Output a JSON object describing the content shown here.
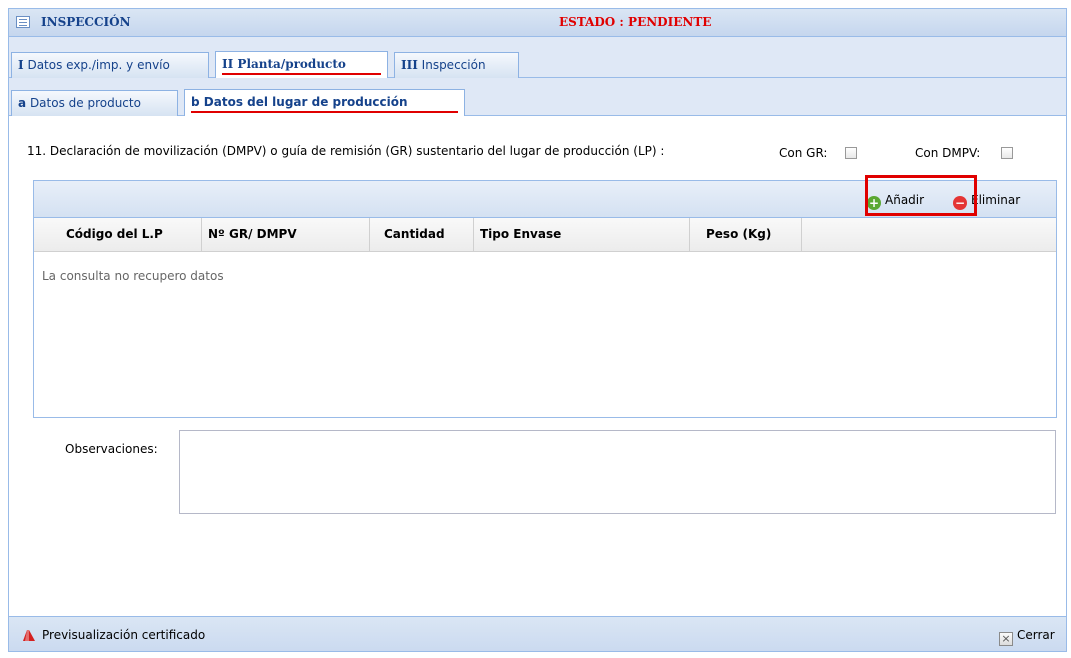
{
  "window": {
    "title": "INSPECCIÓN",
    "status": "ESTADO : PENDIENTE"
  },
  "tabs_level1": [
    {
      "roman": "I",
      "label": "Datos exp./imp. y envío"
    },
    {
      "roman": "II",
      "label": "Planta/producto"
    },
    {
      "roman": "III",
      "label": "Inspección"
    }
  ],
  "tabs_level2": [
    {
      "letter": "a",
      "label": "Datos de producto"
    },
    {
      "letter": "b",
      "label": "Datos del lugar de producción"
    }
  ],
  "section": {
    "label": "11. Declaración de movilización (DMPV) o guía de remisión (GR) sustentario del lugar de producción (LP) :",
    "con_gr_label": "Con GR:",
    "con_dmpv_label": "Con DMPV:"
  },
  "toolbar": {
    "add_label": "Añadir",
    "remove_label": "Eliminar"
  },
  "grid": {
    "columns": [
      "Código del L.P",
      "Nº GR/ DMPV",
      "Cantidad",
      "Tipo Envase",
      "Peso (Kg)"
    ],
    "empty_text": "La consulta no recupero datos"
  },
  "observaciones": {
    "label": "Observaciones:",
    "value": ""
  },
  "footer": {
    "preview_label": "Previsualización certificado",
    "close_label": "Cerrar"
  },
  "colors": {
    "accent_red": "#e00000",
    "header_blue": "#15428b",
    "border_blue": "#99bbe8"
  }
}
